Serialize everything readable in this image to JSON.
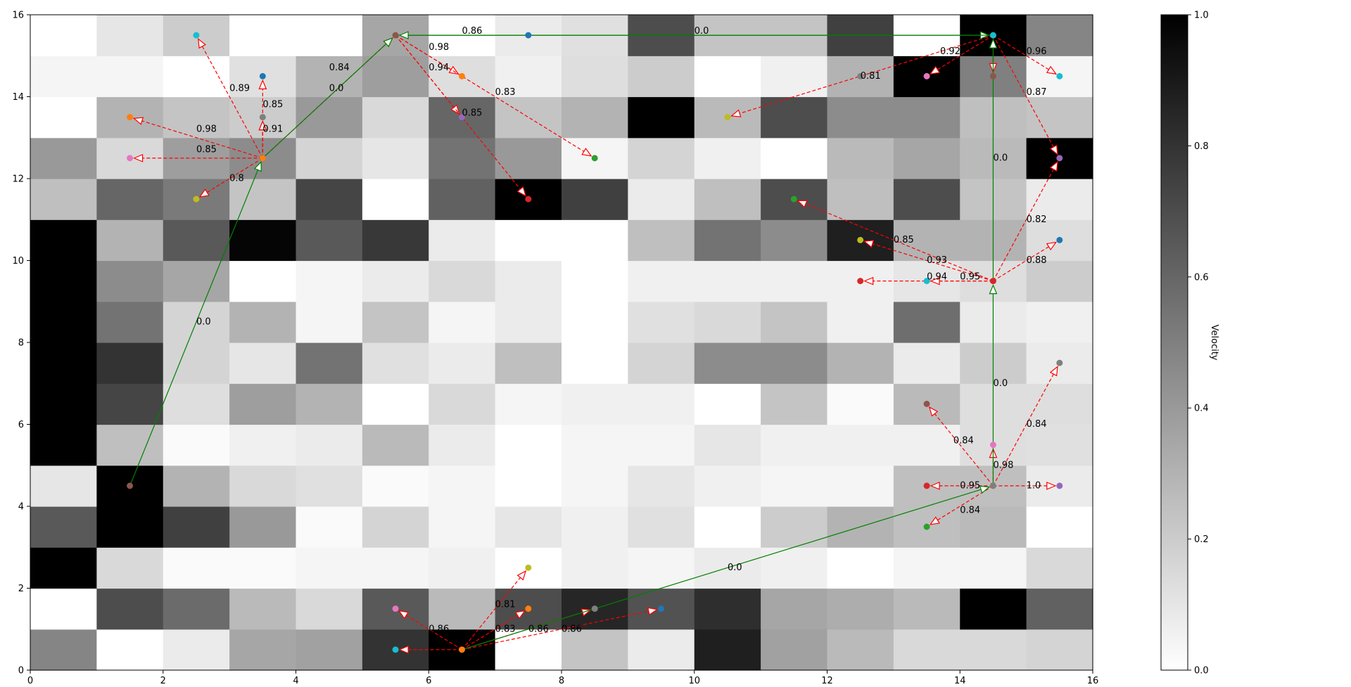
{
  "chart_data": {
    "type": "heatmap",
    "title": "",
    "xlabel": "",
    "ylabel": "",
    "xlim": [
      0,
      16
    ],
    "ylim": [
      0,
      16
    ],
    "x_ticks": [
      "0",
      "2",
      "4",
      "6",
      "8",
      "10",
      "12",
      "14",
      "16"
    ],
    "y_ticks": [
      "0",
      "2",
      "4",
      "6",
      "8",
      "10",
      "12",
      "14",
      "16"
    ],
    "grid": false,
    "colormap": "Greys",
    "colorbar": {
      "label": "Velocity",
      "range": [
        0.0,
        1.0
      ],
      "ticks": [
        "0.0",
        "0.2",
        "0.4",
        "0.6",
        "0.8",
        "1.0"
      ]
    },
    "grid_values": [
      [
        0.48,
        0.0,
        0.08,
        0.35,
        0.37,
        0.8,
        1.0,
        0.0,
        0.23,
        0.08,
        0.88,
        0.37,
        0.27,
        0.15,
        0.15,
        0.17
      ],
      [
        0.0,
        0.7,
        0.58,
        0.27,
        0.15,
        0.65,
        0.27,
        0.7,
        0.85,
        0.68,
        0.82,
        0.35,
        0.32,
        0.27,
        1.0,
        0.62
      ],
      [
        1.0,
        0.15,
        0.02,
        0.02,
        0.04,
        0.04,
        0.06,
        0.0,
        0.06,
        0.04,
        0.08,
        0.06,
        0.0,
        0.04,
        0.04,
        0.15
      ],
      [
        0.65,
        1.0,
        0.75,
        0.4,
        0.02,
        0.17,
        0.04,
        0.1,
        0.06,
        0.12,
        0.0,
        0.2,
        0.3,
        0.25,
        0.27,
        0.0
      ],
      [
        0.1,
        1.0,
        0.3,
        0.15,
        0.12,
        0.02,
        0.04,
        0.0,
        0.04,
        0.1,
        0.06,
        0.04,
        0.04,
        0.25,
        0.25,
        0.08
      ],
      [
        1.0,
        0.25,
        0.02,
        0.06,
        0.08,
        0.27,
        0.08,
        0.0,
        0.04,
        0.04,
        0.1,
        0.06,
        0.06,
        0.06,
        0.13,
        0.12
      ],
      [
        1.0,
        0.73,
        0.13,
        0.38,
        0.3,
        0.0,
        0.15,
        0.04,
        0.06,
        0.06,
        0.0,
        0.23,
        0.02,
        0.27,
        0.13,
        0.13
      ],
      [
        1.0,
        0.8,
        0.17,
        0.1,
        0.55,
        0.12,
        0.08,
        0.25,
        0.0,
        0.17,
        0.45,
        0.45,
        0.3,
        0.08,
        0.2,
        0.08
      ],
      [
        1.0,
        0.55,
        0.17,
        0.3,
        0.04,
        0.23,
        0.04,
        0.08,
        0.0,
        0.12,
        0.15,
        0.23,
        0.06,
        0.57,
        0.08,
        0.06
      ],
      [
        1.0,
        0.45,
        0.35,
        0.0,
        0.04,
        0.08,
        0.15,
        0.08,
        0.0,
        0.06,
        0.06,
        0.06,
        0.06,
        0.1,
        0.13,
        0.2
      ],
      [
        1.0,
        0.3,
        0.65,
        0.98,
        0.65,
        0.78,
        0.08,
        0.0,
        0.0,
        0.25,
        0.55,
        0.45,
        0.88,
        0.3,
        0.3,
        0.13
      ],
      [
        0.25,
        0.6,
        0.52,
        0.23,
        0.73,
        0.0,
        0.62,
        1.0,
        0.75,
        0.08,
        0.25,
        0.7,
        0.25,
        0.7,
        0.23,
        0.08
      ],
      [
        0.4,
        0.15,
        0.38,
        0.45,
        0.17,
        0.1,
        0.55,
        0.4,
        0.04,
        0.17,
        0.06,
        0.0,
        0.27,
        0.35,
        0.27,
        1.0
      ],
      [
        0.0,
        0.3,
        0.23,
        0.2,
        0.4,
        0.15,
        0.6,
        0.23,
        0.3,
        1.0,
        0.27,
        0.7,
        0.45,
        0.45,
        0.25,
        0.23
      ],
      [
        0.04,
        0.04,
        0.0,
        0.12,
        0.3,
        0.38,
        0.13,
        0.06,
        0.13,
        0.2,
        0.0,
        0.06,
        0.3,
        1.0,
        0.5,
        0.04
      ],
      [
        0.0,
        0.1,
        0.2,
        0.0,
        0.0,
        0.35,
        0.0,
        0.08,
        0.12,
        0.7,
        0.23,
        0.23,
        0.75,
        0.0,
        1.0,
        0.48
      ]
    ],
    "points": [
      {
        "x": 2.5,
        "y": 15.5,
        "color": "#17becf"
      },
      {
        "x": 3.5,
        "y": 14.5,
        "color": "#1f77b4"
      },
      {
        "x": 3.5,
        "y": 13.5,
        "color": "#7f7f7f"
      },
      {
        "x": 1.5,
        "y": 13.5,
        "color": "#ff7f0e"
      },
      {
        "x": 1.5,
        "y": 12.5,
        "color": "#e377c2"
      },
      {
        "x": 3.5,
        "y": 12.5,
        "color": "#ff7f0e"
      },
      {
        "x": 2.5,
        "y": 11.5,
        "color": "#bcbd22"
      },
      {
        "x": 5.5,
        "y": 15.5,
        "color": "#8c564b"
      },
      {
        "x": 7.5,
        "y": 15.5,
        "color": "#1f77b4"
      },
      {
        "x": 6.5,
        "y": 14.5,
        "color": "#ff7f0e"
      },
      {
        "x": 6.5,
        "y": 13.5,
        "color": "#9467bd"
      },
      {
        "x": 8.5,
        "y": 12.5,
        "color": "#2ca02c"
      },
      {
        "x": 7.5,
        "y": 11.5,
        "color": "#d62728"
      },
      {
        "x": 14.5,
        "y": 15.5,
        "color": "#17becf"
      },
      {
        "x": 14.5,
        "y": 14.5,
        "color": "#8c564b"
      },
      {
        "x": 15.5,
        "y": 14.5,
        "color": "#17becf"
      },
      {
        "x": 13.5,
        "y": 14.5,
        "color": "#e377c2"
      },
      {
        "x": 12.5,
        "y": 14.5,
        "color": "#7f7f7f"
      },
      {
        "x": 10.5,
        "y": 13.5,
        "color": "#bcbd22"
      },
      {
        "x": 15.5,
        "y": 12.5,
        "color": "#9467bd"
      },
      {
        "x": 11.5,
        "y": 11.5,
        "color": "#2ca02c"
      },
      {
        "x": 12.5,
        "y": 10.5,
        "color": "#bcbd22"
      },
      {
        "x": 15.5,
        "y": 10.5,
        "color": "#1f77b4"
      },
      {
        "x": 12.5,
        "y": 9.5,
        "color": "#d62728"
      },
      {
        "x": 13.5,
        "y": 9.5,
        "color": "#17becf"
      },
      {
        "x": 14.5,
        "y": 9.5,
        "color": "#d62728"
      },
      {
        "x": 15.5,
        "y": 7.5,
        "color": "#7f7f7f"
      },
      {
        "x": 13.5,
        "y": 6.5,
        "color": "#8c564b"
      },
      {
        "x": 14.5,
        "y": 5.5,
        "color": "#e377c2"
      },
      {
        "x": 14.5,
        "y": 4.5,
        "color": "#7f7f7f"
      },
      {
        "x": 13.5,
        "y": 4.5,
        "color": "#d62728"
      },
      {
        "x": 15.5,
        "y": 4.5,
        "color": "#9467bd"
      },
      {
        "x": 13.5,
        "y": 3.5,
        "color": "#2ca02c"
      },
      {
        "x": 1.5,
        "y": 4.5,
        "color": "#8c564b"
      },
      {
        "x": 7.5,
        "y": 2.5,
        "color": "#bcbd22"
      },
      {
        "x": 5.5,
        "y": 1.5,
        "color": "#e377c2"
      },
      {
        "x": 7.5,
        "y": 1.5,
        "color": "#ff7f0e"
      },
      {
        "x": 8.5,
        "y": 1.5,
        "color": "#7f7f7f"
      },
      {
        "x": 9.5,
        "y": 1.5,
        "color": "#1f77b4"
      },
      {
        "x": 5.5,
        "y": 0.5,
        "color": "#17becf"
      },
      {
        "x": 6.5,
        "y": 0.5,
        "color": "#ff7f0e"
      }
    ],
    "candidate_edges": [
      {
        "from": [
          3.5,
          12.5
        ],
        "to": [
          2.5,
          15.5
        ],
        "label": "0.89",
        "lx": 3.0,
        "ly": 14.2
      },
      {
        "from": [
          3.5,
          12.5
        ],
        "to": [
          3.5,
          14.5
        ],
        "label": "",
        "lx": 0,
        "ly": 0
      },
      {
        "from": [
          3.5,
          12.5
        ],
        "to": [
          3.5,
          13.5
        ],
        "label": "0.85",
        "lx": 3.5,
        "ly": 13.8
      },
      {
        "from": [
          3.5,
          12.5
        ],
        "to": [
          1.5,
          13.5
        ],
        "label": "0.98",
        "lx": 2.5,
        "ly": 13.2
      },
      {
        "from": [
          3.5,
          12.5
        ],
        "to": [
          1.5,
          12.5
        ],
        "label": "0.85",
        "lx": 2.5,
        "ly": 12.7
      },
      {
        "from": [
          3.5,
          12.5
        ],
        "to": [
          2.5,
          11.5
        ],
        "label": "0.8",
        "lx": 3.0,
        "ly": 12.0
      },
      {
        "from": [
          3.5,
          12.5
        ],
        "to": [
          3.5,
          13.5
        ],
        "label": "0.91",
        "lx": 3.5,
        "ly": 13.2
      },
      {
        "from": [
          3.5,
          12.5
        ],
        "to": [
          5.5,
          15.5
        ],
        "label": "0.84",
        "lx": 4.5,
        "ly": 14.7
      },
      {
        "from": [
          5.5,
          15.5
        ],
        "to": [
          6.5,
          14.5
        ],
        "label": "0.98",
        "lx": 6.0,
        "ly": 15.2
      },
      {
        "from": [
          5.5,
          15.5
        ],
        "to": [
          6.5,
          13.5
        ],
        "label": "0.94",
        "lx": 6.0,
        "ly": 14.7
      },
      {
        "from": [
          5.5,
          15.5
        ],
        "to": [
          8.5,
          12.5
        ],
        "label": "0.83",
        "lx": 7.0,
        "ly": 14.1
      },
      {
        "from": [
          5.5,
          15.5
        ],
        "to": [
          7.5,
          11.5
        ],
        "label": "0.85",
        "lx": 6.5,
        "ly": 13.6
      },
      {
        "from": [
          14.5,
          15.5
        ],
        "to": [
          13.5,
          14.5
        ],
        "label": "0.92",
        "lx": 13.7,
        "ly": 15.1
      },
      {
        "from": [
          14.5,
          15.5
        ],
        "to": [
          14.5,
          14.5
        ],
        "label": "",
        "lx": 0,
        "ly": 0
      },
      {
        "from": [
          14.5,
          15.5
        ],
        "to": [
          15.5,
          14.5
        ],
        "label": "0.96",
        "lx": 15.0,
        "ly": 15.1
      },
      {
        "from": [
          14.5,
          15.5
        ],
        "to": [
          15.5,
          12.5
        ],
        "label": "0.87",
        "lx": 15.0,
        "ly": 14.1
      },
      {
        "from": [
          14.5,
          15.5
        ],
        "to": [
          10.5,
          13.5
        ],
        "label": "0.81",
        "lx": 12.5,
        "ly": 14.5
      },
      {
        "from": [
          14.5,
          9.5
        ],
        "to": [
          11.5,
          11.5
        ],
        "label": "0.85",
        "lx": 13.0,
        "ly": 10.5
      },
      {
        "from": [
          14.5,
          9.5
        ],
        "to": [
          12.5,
          10.5
        ],
        "label": "0.93",
        "lx": 13.5,
        "ly": 10.0
      },
      {
        "from": [
          14.5,
          9.5
        ],
        "to": [
          12.5,
          9.5
        ],
        "label": "0.94",
        "lx": 13.5,
        "ly": 9.6
      },
      {
        "from": [
          14.5,
          9.5
        ],
        "to": [
          13.5,
          9.5
        ],
        "label": "0.95",
        "lx": 14.0,
        "ly": 9.6
      },
      {
        "from": [
          14.5,
          9.5
        ],
        "to": [
          15.5,
          12.5
        ],
        "label": "0.82",
        "lx": 15.0,
        "ly": 11.0
      },
      {
        "from": [
          14.5,
          9.5
        ],
        "to": [
          15.5,
          10.5
        ],
        "label": "0.88",
        "lx": 15.0,
        "ly": 10.0
      },
      {
        "from": [
          14.5,
          4.5
        ],
        "to": [
          13.5,
          6.5
        ],
        "label": "0.84",
        "lx": 13.9,
        "ly": 5.6
      },
      {
        "from": [
          14.5,
          4.5
        ],
        "to": [
          14.5,
          5.5
        ],
        "label": "0.98",
        "lx": 14.5,
        "ly": 5.0
      },
      {
        "from": [
          14.5,
          4.5
        ],
        "to": [
          15.5,
          7.5
        ],
        "label": "0.84",
        "lx": 15.0,
        "ly": 6.0
      },
      {
        "from": [
          14.5,
          4.5
        ],
        "to": [
          13.5,
          4.5
        ],
        "label": "0.95",
        "lx": 14.0,
        "ly": 4.5
      },
      {
        "from": [
          14.5,
          4.5
        ],
        "to": [
          15.5,
          4.5
        ],
        "label": "1.0",
        "lx": 15.0,
        "ly": 4.5
      },
      {
        "from": [
          14.5,
          4.5
        ],
        "to": [
          13.5,
          3.5
        ],
        "label": "0.84",
        "lx": 14.0,
        "ly": 3.9
      },
      {
        "from": [
          6.5,
          0.5
        ],
        "to": [
          5.5,
          1.5
        ],
        "label": "0.86",
        "lx": 6.0,
        "ly": 1.0
      },
      {
        "from": [
          6.5,
          0.5
        ],
        "to": [
          5.5,
          0.5
        ],
        "label": "",
        "lx": 0,
        "ly": 0
      },
      {
        "from": [
          6.5,
          0.5
        ],
        "to": [
          7.5,
          2.5
        ],
        "label": "0.81",
        "lx": 7.0,
        "ly": 1.6
      },
      {
        "from": [
          6.5,
          0.5
        ],
        "to": [
          7.5,
          1.5
        ],
        "label": "0.83",
        "lx": 7.0,
        "ly": 1.0
      },
      {
        "from": [
          6.5,
          0.5
        ],
        "to": [
          8.5,
          1.5
        ],
        "label": "0.86",
        "lx": 7.5,
        "ly": 1.0
      },
      {
        "from": [
          6.5,
          0.5
        ],
        "to": [
          9.5,
          1.5
        ],
        "label": "0.86",
        "lx": 8.0,
        "ly": 1.0
      }
    ],
    "path_edges": [
      {
        "from": [
          1.5,
          4.5
        ],
        "to": [
          3.5,
          12.5
        ],
        "label": "0.0",
        "lx": 2.5,
        "ly": 8.5
      },
      {
        "from": [
          3.5,
          12.5
        ],
        "to": [
          5.5,
          15.5
        ],
        "label": "0.0",
        "lx": 4.5,
        "ly": 14.2
      },
      {
        "from": [
          5.5,
          15.5
        ],
        "to": [
          14.5,
          15.5
        ],
        "label": "0.86",
        "lx": 6.5,
        "ly": 15.6
      },
      {
        "from": [
          14.5,
          15.5
        ],
        "to": [
          5.5,
          15.5
        ],
        "label": "0.0",
        "lx": 10.0,
        "ly": 15.6
      },
      {
        "from": [
          14.5,
          9.5
        ],
        "to": [
          14.5,
          15.5
        ],
        "label": "0.0",
        "lx": 14.5,
        "ly": 12.5
      },
      {
        "from": [
          14.5,
          4.5
        ],
        "to": [
          14.5,
          9.5
        ],
        "label": "0.0",
        "lx": 14.5,
        "ly": 7.0
      },
      {
        "from": [
          6.5,
          0.5
        ],
        "to": [
          14.5,
          4.5
        ],
        "label": "0.0",
        "lx": 10.5,
        "ly": 2.5
      }
    ]
  }
}
